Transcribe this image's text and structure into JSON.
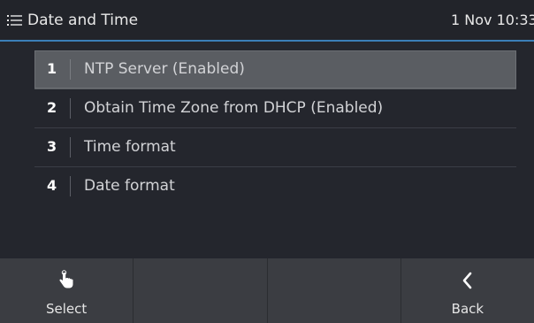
{
  "header": {
    "icon": "menu-list-icon",
    "title": "Date and Time",
    "clock": "1 Nov 10:33"
  },
  "menu": {
    "items": [
      {
        "num": "1",
        "label": "NTP Server (Enabled)",
        "selected": true
      },
      {
        "num": "2",
        "label": "Obtain Time Zone from DHCP (Enabled)",
        "selected": false
      },
      {
        "num": "3",
        "label": "Time format",
        "selected": false
      },
      {
        "num": "4",
        "label": "Date format",
        "selected": false
      }
    ]
  },
  "softkeys": [
    {
      "label": "Select",
      "icon": "touch-hand-icon"
    },
    {
      "label": "",
      "icon": ""
    },
    {
      "label": "",
      "icon": ""
    },
    {
      "label": "Back",
      "icon": "chevron-left-icon"
    }
  ],
  "colors": {
    "background": "#24262d",
    "header_underline": "#3b7fb8",
    "selected_row": "#5a5d62",
    "softkey_bar": "#3b3d42"
  }
}
